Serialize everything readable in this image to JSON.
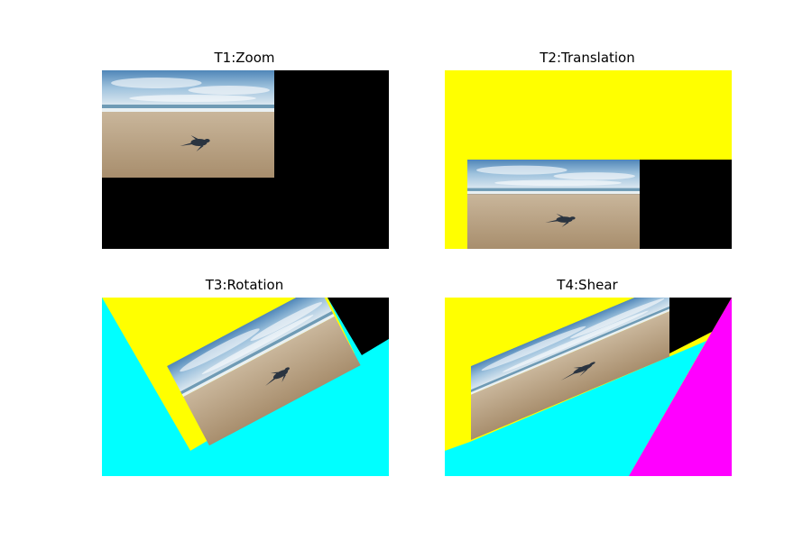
{
  "figure": {
    "panels": [
      {
        "id": "t1",
        "title": "T1:Zoom"
      },
      {
        "id": "t2",
        "title": "T2:Translation"
      },
      {
        "id": "t3",
        "title": "T3:Rotation"
      },
      {
        "id": "t4",
        "title": "T4:Shear"
      }
    ]
  },
  "chart_data": [
    {
      "type": "image",
      "title": "T1:Zoom",
      "axes": "off",
      "content": "beach photo with baby sea turtle, scaled down into top-left",
      "fill_color": "#000000"
    },
    {
      "type": "image",
      "title": "T2:Translation",
      "axes": "off",
      "content": "beach photo with baby sea turtle, translated toward bottom-right",
      "fill_colors": [
        "#ffff00",
        "#000000"
      ]
    },
    {
      "type": "image",
      "title": "T3:Rotation",
      "axes": "off",
      "content": "beach photo with baby sea turtle, rotated",
      "fill_colors": [
        "#ffff00",
        "#00ffff",
        "#000000"
      ]
    },
    {
      "type": "image",
      "title": "T4:Shear",
      "axes": "off",
      "content": "beach photo with baby sea turtle, sheared",
      "fill_colors": [
        "#ffff00",
        "#00ffff",
        "#ff00ff",
        "#000000"
      ]
    }
  ],
  "colors": {
    "black": "#000000",
    "yellow": "#ffff00",
    "cyan": "#00ffff",
    "magenta": "#ff00ff",
    "sky": "#6a9cc8",
    "sand": "#b9a282",
    "turtle": "#2a3440"
  },
  "icons": {
    "photo": "turtle-beach-photo"
  }
}
